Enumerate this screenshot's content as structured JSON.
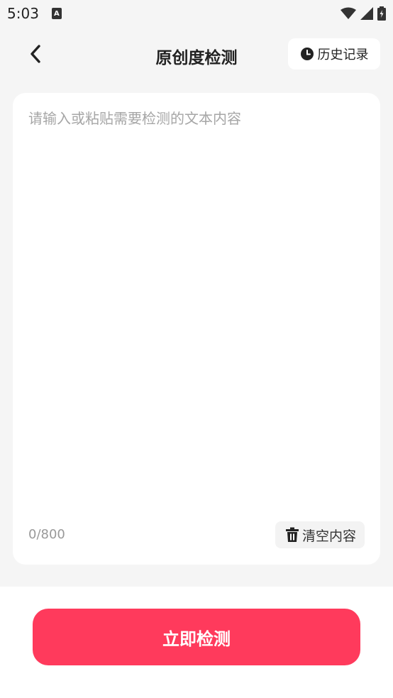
{
  "status_bar": {
    "time": "5:03",
    "icons": [
      "a-notification-icon",
      "wifi-icon",
      "signal-icon",
      "battery-icon"
    ]
  },
  "header": {
    "title": "原创度检测",
    "back_icon": "chevron-left-icon",
    "history": {
      "label": "历史记录",
      "icon": "clock-icon"
    }
  },
  "editor": {
    "placeholder": "请输入或粘贴需要检测的文本内容",
    "value": "",
    "char_count": "0/800",
    "clear": {
      "label": "清空内容",
      "icon": "trash-icon"
    }
  },
  "action": {
    "detect_label": "立即检测"
  },
  "colors": {
    "accent": "#ff3a5c",
    "background": "#f5f5f5",
    "card": "#ffffff"
  }
}
